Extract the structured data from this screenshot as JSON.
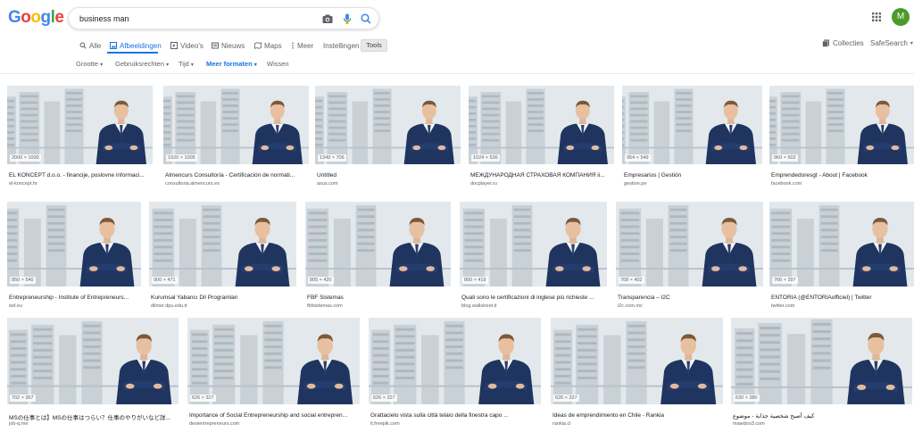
{
  "header": {
    "logo_letters": [
      "G",
      "o",
      "o",
      "g",
      "l",
      "e"
    ],
    "search_value": "business man",
    "avatar_initial": "M"
  },
  "tabs": {
    "all": "Alle",
    "images": "Afbeeldingen",
    "videos": "Video's",
    "news": "Nieuws",
    "maps": "Maps",
    "more": "Meer",
    "settings": "Instellingen",
    "tools": "Tools",
    "collections": "Collecties",
    "safesearch": "SafeSearch"
  },
  "filters": {
    "size": "Grootte",
    "rights": "Gebruiksrechten",
    "time": "Tijd",
    "more_formats": "Meer formaten",
    "clear": "Wissen"
  },
  "results": [
    {
      "dims": "2000 × 1000",
      "title": "EL KONCEPT d.o.o. - financije, poslovne informaci...",
      "source": "el-koncept.hr"
    },
    {
      "dims": "1920 × 1005",
      "title": "Almencurs Consultoría - Certificación de normati...",
      "source": "consultoria.almencurs.es"
    },
    {
      "dims": "1349 × 706",
      "title": "Untitled",
      "source": "asus.com"
    },
    {
      "dims": "1024 × 536",
      "title": "МЕЖДУНАРОДНАЯ СТРАХОВАЯ КОМПАНИЯ ii...",
      "source": "docplayer.ru"
    },
    {
      "dims": "954 × 549",
      "title": "Empresarios | Gestión",
      "source": "gestion.pe"
    },
    {
      "dims": "960 × 502",
      "title": "Emprendedoresgt - About | Facebook",
      "source": "facebook.com"
    },
    {
      "dims": "850 × 540",
      "title": "Entrepreneurship - Institute of Entrepreneurs...",
      "source": "ied.eu"
    },
    {
      "dims": "900 × 471",
      "title": "Kurumsal Yabancı Dil Programları",
      "source": "dilmer.dpu.edu.tr"
    },
    {
      "dims": "805 × 420",
      "title": "FBF Sistemas",
      "source": "fbfsistemas.com"
    },
    {
      "dims": "800 × 419",
      "title": "Quali sono le certificazioni di inglese più richieste ...",
      "source": "blog.wallstreet.it"
    },
    {
      "dims": "768 × 402",
      "title": "Transparencia – I2C",
      "source": "i2c.com.mx"
    },
    {
      "dims": "766 × 397",
      "title": "ENTORIA (@ENTORIAofficiel) | Twitter",
      "source": "twitter.com"
    },
    {
      "dims": "702 × 367",
      "title": "MSの仕事とは】MSの仕事はつらい？仕事のやりがいなど詳...",
      "source": "job-q.me"
    },
    {
      "dims": "626 × 327",
      "title": "Importance of Social Entrepreneurship and social entrepren...",
      "source": "desientrepreneurs.com"
    },
    {
      "dims": "626 × 327",
      "title": "Grattacielo vista sulla città telaio della finestra capo ...",
      "source": "it.freepik.com"
    },
    {
      "dims": "626 × 327",
      "title": "Ideas de emprendimiento en Chile - Rankia",
      "source": "rankia.cl"
    },
    {
      "dims": "630 × 380",
      "title": "كيف أصبح شخصية جذابة - موضوع",
      "source": "mawdoo3.com"
    }
  ],
  "colors": {
    "accent": "#1a73e8",
    "logo": [
      "#4285f4",
      "#ea4335",
      "#fbbc05",
      "#4285f4",
      "#34a853",
      "#ea4335"
    ]
  }
}
